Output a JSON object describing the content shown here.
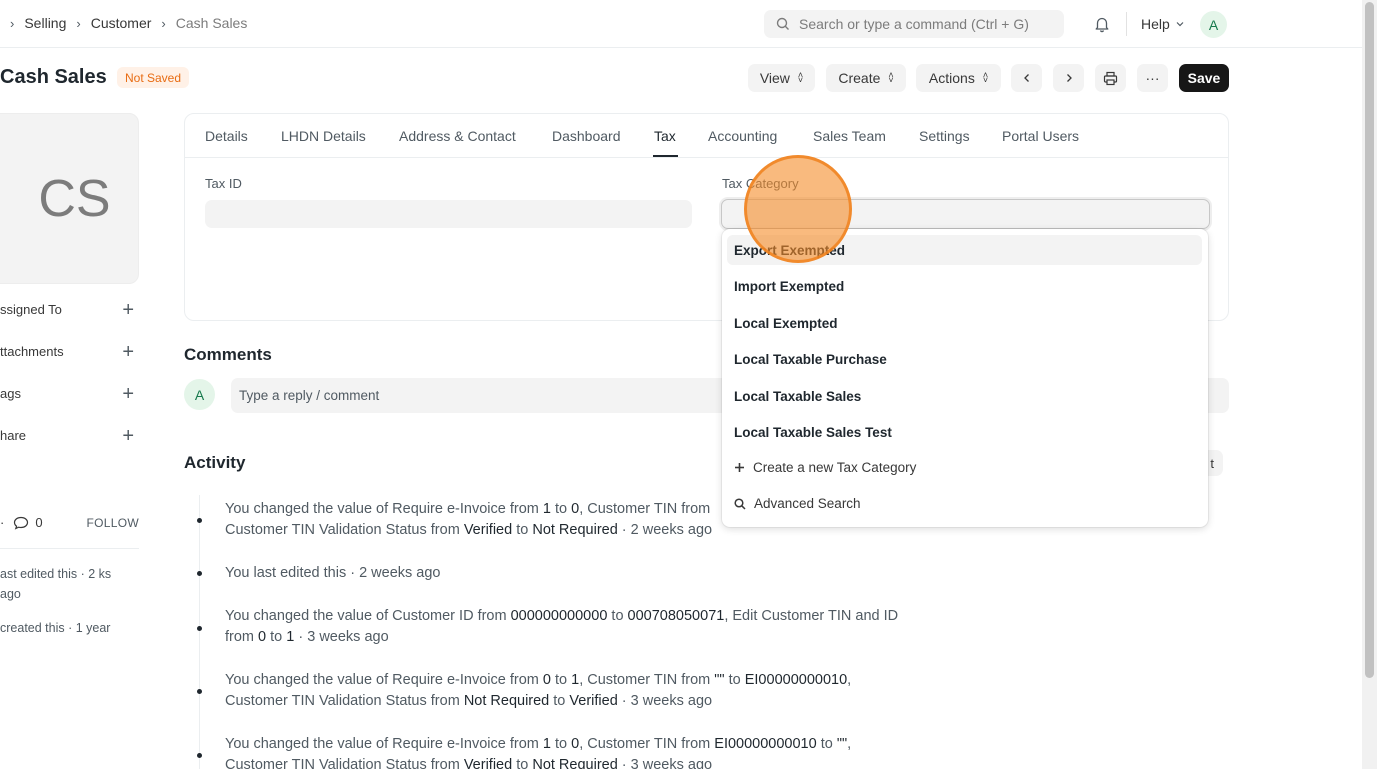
{
  "breadcrumbs": [
    "Selling",
    "Customer",
    "Cash Sales"
  ],
  "search": {
    "placeholder": "Search or type a command (Ctrl + G)"
  },
  "help_label": "Help",
  "user_initial": "A",
  "page": {
    "title": "Cash Sales",
    "status_badge": "Not Saved",
    "buttons": {
      "view": "View",
      "create": "Create",
      "actions": "Actions",
      "more": "···",
      "save": "Save"
    }
  },
  "sidebar": {
    "image_initials": "CS",
    "items": [
      "ssigned To",
      "ttachments",
      "ags",
      "hare"
    ],
    "likes_prefix": "·",
    "comment_count": "0",
    "follow_label": "FOLLOW",
    "notes": [
      "ast edited this · 2 ks ago",
      "created this · 1 year"
    ]
  },
  "tabs": [
    "Details",
    "LHDN Details",
    "Address & Contact",
    "Dashboard",
    "Tax",
    "Accounting",
    "Sales Team",
    "Settings",
    "Portal Users"
  ],
  "active_tab": "Tax",
  "fields": {
    "tax_id_label": "Tax ID",
    "tax_category_label": "Tax Category"
  },
  "comments": {
    "title": "Comments",
    "avatar": "A",
    "placeholder": "Type a reply / comment"
  },
  "activity": {
    "title": "Activity",
    "new_email_partial": "t",
    "entries": [
      {
        "parts": [
          "You changed the value of Require e-Invoice from ",
          "1",
          " to ",
          "0",
          ", Customer TIN from ",
          "",
          "",
          "",
          "",
          "",
          " Customer TIN Validation Status from ",
          "Verified",
          " to ",
          "Not Required",
          " · 2 weeks ago"
        ]
      },
      {
        "text": "You last edited this · 2 weeks ago"
      },
      {
        "parts": [
          "You changed the value of Customer ID from ",
          "000000000000",
          " to ",
          "000708050071",
          ", Edit Customer TIN and ID from ",
          "0",
          " to ",
          "1",
          " · 3 weeks ago"
        ]
      },
      {
        "parts": [
          "You changed the value of Require e-Invoice from ",
          "0",
          " to ",
          "1",
          ", Customer TIN from ",
          "\"\"",
          " to ",
          "EI00000000010",
          ",",
          " Customer TIN Validation Status from ",
          "Not Required",
          " to ",
          "Verified",
          " · 3 weeks ago"
        ]
      },
      {
        "parts": [
          "You changed the value of Require e-Invoice from ",
          "1",
          " to ",
          "0",
          ", Customer TIN from ",
          "EI00000000010",
          " to ",
          "\"\"",
          ",",
          " Customer TIN Validation Status from ",
          "Verified",
          " to ",
          "Not Required",
          " · 3 weeks ago"
        ]
      }
    ]
  },
  "dropdown": {
    "options": [
      "Export Exempted",
      "Import Exempted",
      "Local Exempted",
      "Local Taxable Purchase",
      "Local Taxable Sales",
      "Local Taxable Sales Test"
    ],
    "create_new": "Create a new Tax Category",
    "advanced_search": "Advanced Search"
  }
}
